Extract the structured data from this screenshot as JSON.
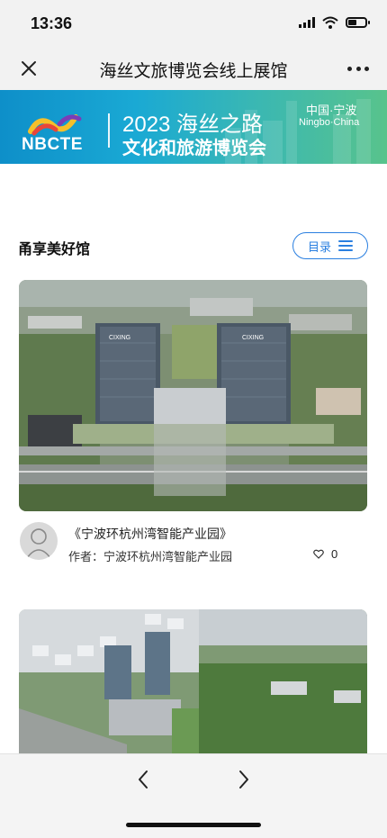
{
  "status_bar": {
    "time": "13:36"
  },
  "nav": {
    "title": "海丝文旅博览会线上展馆"
  },
  "banner": {
    "logo_text": "NBCTE",
    "year_title": "2023 海丝之路",
    "subtitle": "文化和旅游博览会",
    "location_cn": "中国·宁波",
    "location_en": "Ningbo·China"
  },
  "section": {
    "title": "甬享美好馆",
    "catalog_label": "目录"
  },
  "card": {
    "title": "《宁波环杭州湾智能产业园》",
    "author": "作者：宁波环杭州湾智能产业园",
    "likes": "0",
    "building_sign": "CIXING"
  },
  "icons": {
    "close": "close-icon",
    "more": "more-dots-icon",
    "menu": "menu-lines-icon",
    "heart": "heart-icon",
    "back": "chevron-left-icon",
    "forward": "chevron-right-icon"
  },
  "colors": {
    "accent": "#2a7fe0",
    "banner_start": "#0e8fc9",
    "banner_end": "#58c38c"
  }
}
